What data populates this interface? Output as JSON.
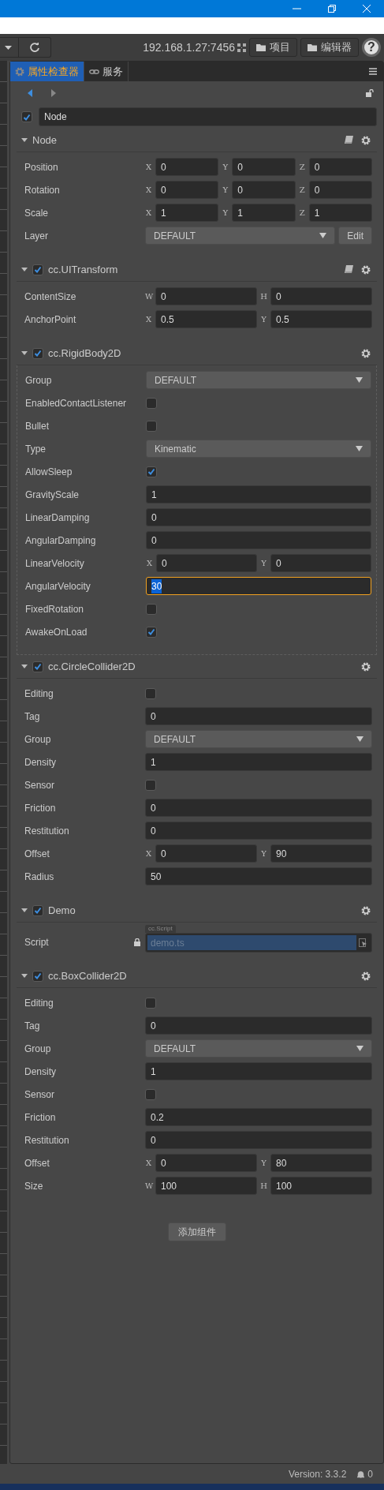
{
  "toolbar": {
    "address": "192.168.1.27:7456",
    "buttons": [
      "项目",
      "编辑器"
    ],
    "help": "?"
  },
  "tabs": [
    {
      "label": "属性检查器",
      "selected": true
    },
    {
      "label": "服务",
      "selected": false
    }
  ],
  "node": {
    "enabled": true,
    "name": "Node"
  },
  "components": [
    {
      "title": "Node",
      "doc_icon": true,
      "highlighted": false,
      "properties": [
        {
          "label": "Position",
          "kind": "vector",
          "axes": [
            {
              "axis": "X",
              "value": "0"
            },
            {
              "axis": "Y",
              "value": "0"
            },
            {
              "axis": "Z",
              "value": "0"
            }
          ]
        },
        {
          "label": "Rotation",
          "kind": "vector",
          "axes": [
            {
              "axis": "X",
              "value": "0"
            },
            {
              "axis": "Y",
              "value": "0"
            },
            {
              "axis": "Z",
              "value": "0"
            }
          ]
        },
        {
          "label": "Scale",
          "kind": "vector",
          "axes": [
            {
              "axis": "X",
              "value": "1"
            },
            {
              "axis": "Y",
              "value": "1"
            },
            {
              "axis": "Z",
              "value": "1"
            }
          ]
        },
        {
          "label": "Layer",
          "kind": "select",
          "value": "DEFAULT",
          "button": "Edit"
        }
      ]
    },
    {
      "title": "cc.UITransform",
      "enabled": true,
      "doc_icon": true,
      "highlighted": false,
      "properties": [
        {
          "label": "ContentSize",
          "kind": "vector",
          "axes": [
            {
              "axis": "W",
              "value": "0"
            },
            {
              "axis": "H",
              "value": "0"
            }
          ]
        },
        {
          "label": "AnchorPoint",
          "kind": "vector",
          "axes": [
            {
              "axis": "X",
              "value": "0.5"
            },
            {
              "axis": "Y",
              "value": "0.5"
            }
          ]
        }
      ]
    },
    {
      "title": "cc.RigidBody2D",
      "enabled": true,
      "doc_icon": false,
      "highlighted": true,
      "properties": [
        {
          "label": "Group",
          "kind": "select",
          "value": "DEFAULT"
        },
        {
          "label": "EnabledContactListener",
          "kind": "checkbox",
          "checked": false
        },
        {
          "label": "Bullet",
          "kind": "checkbox",
          "checked": false
        },
        {
          "label": "Type",
          "kind": "select",
          "value": "Kinematic"
        },
        {
          "label": "AllowSleep",
          "kind": "checkbox",
          "checked": true
        },
        {
          "label": "GravityScale",
          "kind": "number",
          "value": "1",
          "focused": false
        },
        {
          "label": "LinearDamping",
          "kind": "number",
          "value": "0",
          "focused": false
        },
        {
          "label": "AngularDamping",
          "kind": "number",
          "value": "0",
          "focused": false
        },
        {
          "label": "LinearVelocity",
          "kind": "vector",
          "axes": [
            {
              "axis": "X",
              "value": "0"
            },
            {
              "axis": "Y",
              "value": "0"
            }
          ]
        },
        {
          "label": "AngularVelocity",
          "kind": "number",
          "value": "30",
          "focused": true
        },
        {
          "label": "FixedRotation",
          "kind": "checkbox",
          "checked": false
        },
        {
          "label": "AwakeOnLoad",
          "kind": "checkbox",
          "checked": true
        }
      ]
    },
    {
      "title": "cc.CircleCollider2D",
      "enabled": true,
      "doc_icon": false,
      "highlighted": false,
      "properties": [
        {
          "label": "Editing",
          "kind": "checkbox",
          "checked": false
        },
        {
          "label": "Tag",
          "kind": "number",
          "value": "0",
          "focused": false
        },
        {
          "label": "Group",
          "kind": "select",
          "value": "DEFAULT"
        },
        {
          "label": "Density",
          "kind": "number",
          "value": "1",
          "focused": false
        },
        {
          "label": "Sensor",
          "kind": "checkbox",
          "checked": false
        },
        {
          "label": "Friction",
          "kind": "number",
          "value": "0",
          "focused": false
        },
        {
          "label": "Restitution",
          "kind": "number",
          "value": "0",
          "focused": false
        },
        {
          "label": "Offset",
          "kind": "vector",
          "axes": [
            {
              "axis": "X",
              "value": "0"
            },
            {
              "axis": "Y",
              "value": "90"
            }
          ]
        },
        {
          "label": "Radius",
          "kind": "number",
          "value": "50",
          "focused": false
        }
      ]
    },
    {
      "title": "Demo",
      "enabled": true,
      "doc_icon": false,
      "highlighted": false,
      "properties": [
        {
          "label": "Script",
          "kind": "script",
          "type_tag": "cc.Script",
          "value": "demo.ts"
        }
      ]
    },
    {
      "title": "cc.BoxCollider2D",
      "enabled": true,
      "doc_icon": false,
      "highlighted": false,
      "properties": [
        {
          "label": "Editing",
          "kind": "checkbox",
          "checked": false
        },
        {
          "label": "Tag",
          "kind": "number",
          "value": "0",
          "focused": false
        },
        {
          "label": "Group",
          "kind": "select",
          "value": "DEFAULT"
        },
        {
          "label": "Density",
          "kind": "number",
          "value": "1",
          "focused": false
        },
        {
          "label": "Sensor",
          "kind": "checkbox",
          "checked": false
        },
        {
          "label": "Friction",
          "kind": "number",
          "value": "0.2",
          "focused": false
        },
        {
          "label": "Restitution",
          "kind": "number",
          "value": "0",
          "focused": false
        },
        {
          "label": "Offset",
          "kind": "vector",
          "axes": [
            {
              "axis": "X",
              "value": "0"
            },
            {
              "axis": "Y",
              "value": "80"
            }
          ]
        },
        {
          "label": "Size",
          "kind": "vector",
          "axes": [
            {
              "axis": "W",
              "value": "100"
            },
            {
              "axis": "H",
              "value": "100"
            }
          ]
        }
      ]
    }
  ],
  "add_component_button": "添加组件",
  "status_bar": {
    "version": "Version: 3.3.2",
    "notifications": "0"
  }
}
